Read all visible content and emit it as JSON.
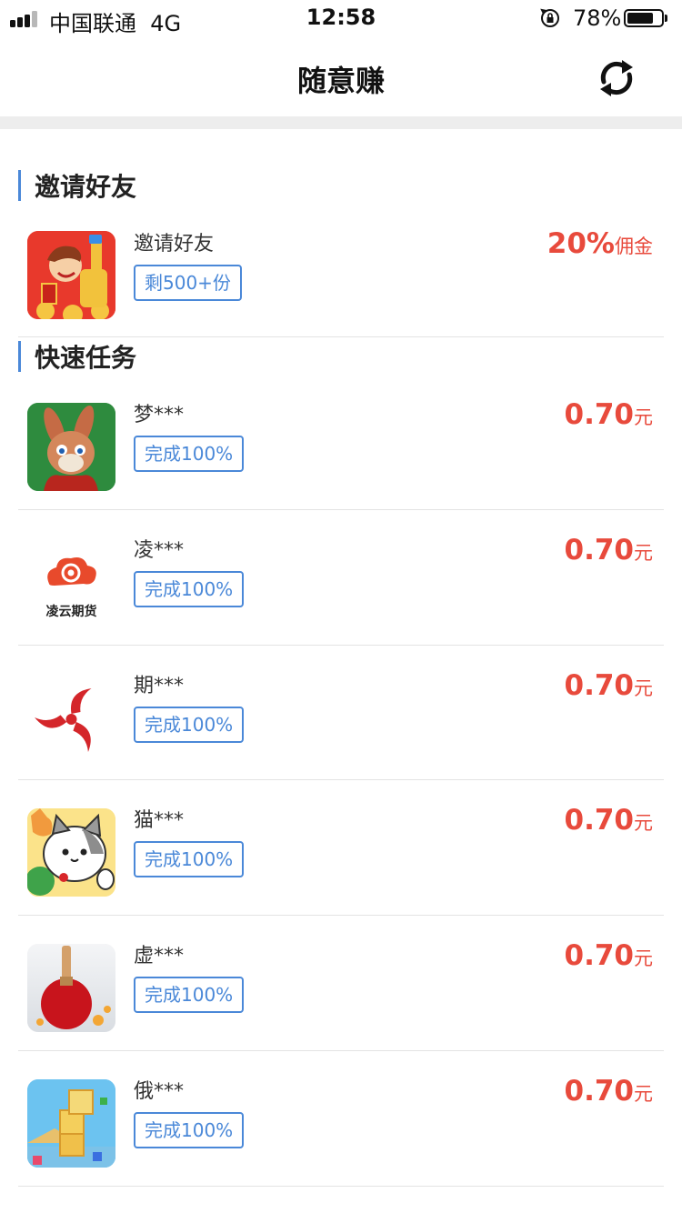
{
  "status_bar": {
    "carrier": "中国联通",
    "network": "4G",
    "time": "12:58",
    "battery_percent": "78%",
    "battery_level": 0.78
  },
  "nav": {
    "title": "随意赚",
    "refresh_icon": "refresh-icon"
  },
  "sections": {
    "invite": {
      "title": "邀请好友",
      "item": {
        "name": "邀请好友",
        "tag": "剩500+份",
        "reward_amount": "20%",
        "reward_unit": "佣金",
        "icon": "cartoon-boy-icon"
      }
    },
    "quick": {
      "title": "快速任务",
      "items": [
        {
          "name": "梦***",
          "tag": "完成100%",
          "reward_amount": "0.70",
          "reward_unit": "元",
          "icon": "rabbit-game-icon"
        },
        {
          "name": "凌***",
          "tag": "完成100%",
          "reward_amount": "0.70",
          "reward_unit": "元",
          "icon": "lingyun-futures-icon",
          "icon_text": "凌云期货"
        },
        {
          "name": "期***",
          "tag": "完成100%",
          "reward_amount": "0.70",
          "reward_unit": "元",
          "icon": "red-swirl-icon"
        },
        {
          "name": "猫***",
          "tag": "完成100%",
          "reward_amount": "0.70",
          "reward_unit": "元",
          "icon": "cats-game-icon"
        },
        {
          "name": "虚***",
          "tag": "完成100%",
          "reward_amount": "0.70",
          "reward_unit": "元",
          "icon": "ping-pong-icon"
        },
        {
          "name": "俄***",
          "tag": "完成100%",
          "reward_amount": "0.70",
          "reward_unit": "元",
          "icon": "block-puzzle-icon"
        }
      ]
    }
  },
  "colors": {
    "accent_blue": "#4a88d8",
    "reward_red": "#e84a3c",
    "divider": "#e3e3e3"
  }
}
